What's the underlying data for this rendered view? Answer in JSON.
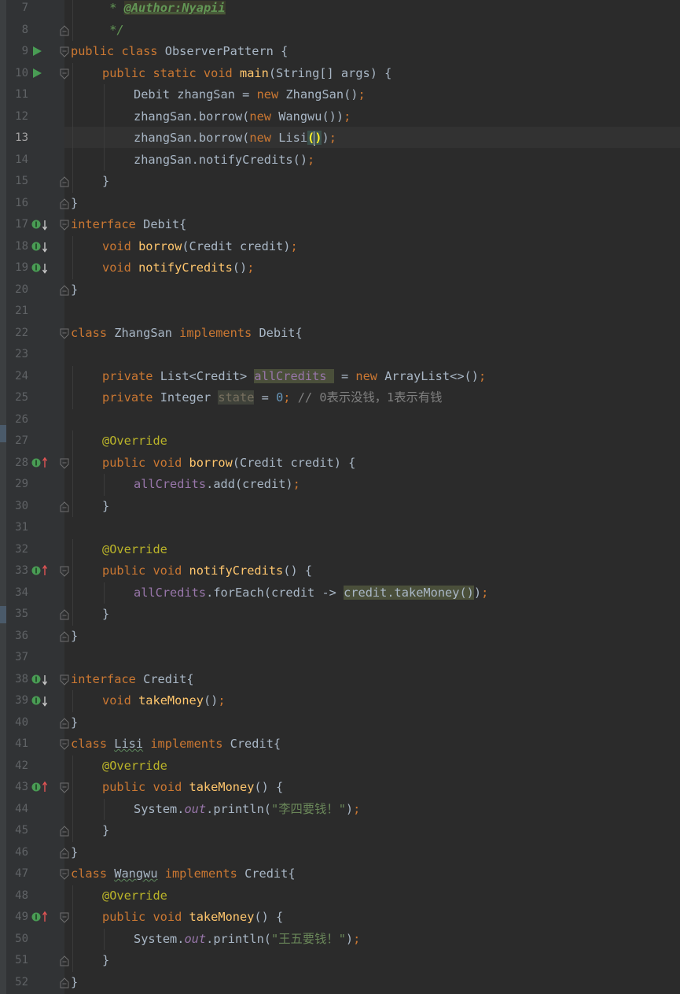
{
  "editor": {
    "current_line": 13,
    "lines": [
      {
        "num": "7",
        "indent": 1,
        "gutter": "",
        "fold": "",
        "tokens": [
          {
            "t": " * ",
            "c": "doc"
          },
          {
            "t": "@Author:Nyapii",
            "c": "dtag"
          }
        ]
      },
      {
        "num": "8",
        "indent": 1,
        "gutter": "",
        "fold": "end",
        "tokens": [
          {
            "t": " */",
            "c": "doc"
          }
        ]
      },
      {
        "num": "9",
        "indent": 0,
        "gutter": "run",
        "fold": "start",
        "tokens": [
          {
            "t": "public class ",
            "c": "kw"
          },
          {
            "t": "ObserverPattern {",
            "c": ""
          }
        ]
      },
      {
        "num": "10",
        "indent": 1,
        "gutter": "run",
        "fold": "start",
        "tokens": [
          {
            "t": "public static void ",
            "c": "kw"
          },
          {
            "t": "main",
            "c": "fn"
          },
          {
            "t": "(String[] args) {",
            "c": ""
          }
        ]
      },
      {
        "num": "11",
        "indent": 2,
        "gutter": "",
        "fold": "",
        "tokens": [
          {
            "t": "Debit zhangSan = ",
            "c": ""
          },
          {
            "t": "new ",
            "c": "kw"
          },
          {
            "t": "ZhangSan()",
            "c": ""
          },
          {
            "t": ";",
            "c": "kw"
          }
        ]
      },
      {
        "num": "12",
        "indent": 2,
        "gutter": "",
        "fold": "",
        "tokens": [
          {
            "t": "zhangSan.borrow(",
            "c": ""
          },
          {
            "t": "new ",
            "c": "kw"
          },
          {
            "t": "Wangwu())",
            "c": ""
          },
          {
            "t": ";",
            "c": "kw"
          }
        ]
      },
      {
        "num": "13",
        "indent": 2,
        "gutter": "",
        "fold": "",
        "tokens": [
          {
            "t": "zhangSan.borrow(",
            "c": ""
          },
          {
            "t": "new ",
            "c": "kw"
          },
          {
            "t": "Lisi",
            "c": ""
          },
          {
            "t": "(",
            "c": "brace-match"
          },
          {
            "t": "",
            "c": "caret"
          },
          {
            "t": ")",
            "c": "brace-match"
          },
          {
            "t": ")",
            "c": ""
          },
          {
            "t": ";",
            "c": "kw"
          }
        ]
      },
      {
        "num": "14",
        "indent": 2,
        "gutter": "",
        "fold": "",
        "tokens": [
          {
            "t": "zhangSan.notifyCredits()",
            "c": ""
          },
          {
            "t": ";",
            "c": "kw"
          }
        ]
      },
      {
        "num": "15",
        "indent": 1,
        "gutter": "",
        "fold": "end",
        "tokens": [
          {
            "t": "}",
            "c": ""
          }
        ]
      },
      {
        "num": "16",
        "indent": 0,
        "gutter": "",
        "fold": "end",
        "tokens": [
          {
            "t": "}",
            "c": ""
          }
        ]
      },
      {
        "num": "17",
        "indent": 0,
        "gutter": "impl",
        "fold": "start",
        "tokens": [
          {
            "t": "interface ",
            "c": "kw"
          },
          {
            "t": "Debit{",
            "c": ""
          }
        ]
      },
      {
        "num": "18",
        "indent": 1,
        "gutter": "impl",
        "fold": "",
        "tokens": [
          {
            "t": "void ",
            "c": "kw"
          },
          {
            "t": "borrow",
            "c": "fn"
          },
          {
            "t": "(Credit credit)",
            "c": ""
          },
          {
            "t": ";",
            "c": "kw"
          }
        ]
      },
      {
        "num": "19",
        "indent": 1,
        "gutter": "impl",
        "fold": "",
        "tokens": [
          {
            "t": "void ",
            "c": "kw"
          },
          {
            "t": "notifyCredits",
            "c": "fn"
          },
          {
            "t": "()",
            "c": ""
          },
          {
            "t": ";",
            "c": "kw"
          }
        ]
      },
      {
        "num": "20",
        "indent": 0,
        "gutter": "",
        "fold": "end",
        "tokens": [
          {
            "t": "}",
            "c": ""
          }
        ]
      },
      {
        "num": "21",
        "indent": 0,
        "gutter": "",
        "fold": "",
        "tokens": []
      },
      {
        "num": "22",
        "indent": 0,
        "gutter": "",
        "fold": "start",
        "tokens": [
          {
            "t": "class ",
            "c": "kw"
          },
          {
            "t": "ZhangSan ",
            "c": ""
          },
          {
            "t": "implements ",
            "c": "kw"
          },
          {
            "t": "Debit{",
            "c": ""
          }
        ]
      },
      {
        "num": "23",
        "indent": 0,
        "gutter": "",
        "fold": "",
        "tokens": []
      },
      {
        "num": "24",
        "indent": 1,
        "gutter": "",
        "fold": "",
        "tokens": [
          {
            "t": "private ",
            "c": "kw"
          },
          {
            "t": "List<Credit> ",
            "c": ""
          },
          {
            "t": "allCredits ",
            "c": "fld hl-usage"
          },
          {
            "t": " = ",
            "c": ""
          },
          {
            "t": "new ",
            "c": "kw"
          },
          {
            "t": "ArrayList<>()",
            "c": ""
          },
          {
            "t": ";",
            "c": "kw"
          }
        ]
      },
      {
        "num": "25",
        "indent": 1,
        "gutter": "",
        "fold": "",
        "tokens": [
          {
            "t": "private ",
            "c": "kw"
          },
          {
            "t": "Integer ",
            "c": ""
          },
          {
            "t": "state",
            "c": "hl-state"
          },
          {
            "t": " = ",
            "c": ""
          },
          {
            "t": "0",
            "c": "num"
          },
          {
            "t": "; ",
            "c": "kw"
          },
          {
            "t": "// 0表示没钱，1表示有钱",
            "c": "cmt"
          }
        ]
      },
      {
        "num": "26",
        "indent": 0,
        "gutter": "",
        "fold": "",
        "tokens": []
      },
      {
        "num": "27",
        "indent": 1,
        "gutter": "",
        "fold": "",
        "tokens": [
          {
            "t": "@Override",
            "c": "ann"
          }
        ]
      },
      {
        "num": "28",
        "indent": 1,
        "gutter": "over",
        "fold": "start",
        "tokens": [
          {
            "t": "public void ",
            "c": "kw"
          },
          {
            "t": "borrow",
            "c": "fn"
          },
          {
            "t": "(Credit credit) {",
            "c": ""
          }
        ]
      },
      {
        "num": "29",
        "indent": 2,
        "gutter": "",
        "fold": "",
        "tokens": [
          {
            "t": "allCredits",
            "c": "fld"
          },
          {
            "t": ".add(credit)",
            "c": ""
          },
          {
            "t": ";",
            "c": "kw"
          }
        ]
      },
      {
        "num": "30",
        "indent": 1,
        "gutter": "",
        "fold": "end",
        "tokens": [
          {
            "t": "}",
            "c": ""
          }
        ]
      },
      {
        "num": "31",
        "indent": 0,
        "gutter": "",
        "fold": "",
        "tokens": []
      },
      {
        "num": "32",
        "indent": 1,
        "gutter": "",
        "fold": "",
        "tokens": [
          {
            "t": "@Override",
            "c": "ann"
          }
        ]
      },
      {
        "num": "33",
        "indent": 1,
        "gutter": "over",
        "fold": "start",
        "tokens": [
          {
            "t": "public void ",
            "c": "kw"
          },
          {
            "t": "notifyCredits",
            "c": "fn"
          },
          {
            "t": "() {",
            "c": ""
          }
        ]
      },
      {
        "num": "34",
        "indent": 2,
        "gutter": "",
        "fold": "",
        "tokens": [
          {
            "t": "allCredits",
            "c": "fld"
          },
          {
            "t": ".forEach(credit -> ",
            "c": ""
          },
          {
            "t": "credit.takeMoney()",
            "c": "hl-usage"
          },
          {
            "t": ")",
            "c": ""
          },
          {
            "t": ";",
            "c": "kw"
          }
        ]
      },
      {
        "num": "35",
        "indent": 1,
        "gutter": "",
        "fold": "end",
        "tokens": [
          {
            "t": "}",
            "c": ""
          }
        ]
      },
      {
        "num": "36",
        "indent": 0,
        "gutter": "",
        "fold": "end",
        "tokens": [
          {
            "t": "}",
            "c": ""
          }
        ]
      },
      {
        "num": "37",
        "indent": 0,
        "gutter": "",
        "fold": "",
        "tokens": []
      },
      {
        "num": "38",
        "indent": 0,
        "gutter": "impl",
        "fold": "start",
        "tokens": [
          {
            "t": "interface ",
            "c": "kw"
          },
          {
            "t": "Credit{",
            "c": ""
          }
        ]
      },
      {
        "num": "39",
        "indent": 1,
        "gutter": "impl",
        "fold": "",
        "tokens": [
          {
            "t": "void ",
            "c": "kw"
          },
          {
            "t": "takeMoney",
            "c": "fn"
          },
          {
            "t": "()",
            "c": ""
          },
          {
            "t": ";",
            "c": "kw"
          }
        ]
      },
      {
        "num": "40",
        "indent": 0,
        "gutter": "",
        "fold": "end",
        "tokens": [
          {
            "t": "}",
            "c": ""
          }
        ]
      },
      {
        "num": "41",
        "indent": 0,
        "gutter": "",
        "fold": "start",
        "tokens": [
          {
            "t": "class ",
            "c": "kw"
          },
          {
            "t": "Lisi",
            "c": "typo"
          },
          {
            "t": " ",
            "c": ""
          },
          {
            "t": "implements ",
            "c": "kw"
          },
          {
            "t": "Credit{",
            "c": ""
          }
        ]
      },
      {
        "num": "42",
        "indent": 1,
        "gutter": "",
        "fold": "",
        "tokens": [
          {
            "t": "@Override",
            "c": "ann"
          }
        ]
      },
      {
        "num": "43",
        "indent": 1,
        "gutter": "over",
        "fold": "start",
        "tokens": [
          {
            "t": "public void ",
            "c": "kw"
          },
          {
            "t": "takeMoney",
            "c": "fn"
          },
          {
            "t": "() {",
            "c": ""
          }
        ]
      },
      {
        "num": "44",
        "indent": 2,
        "gutter": "",
        "fold": "",
        "tokens": [
          {
            "t": "System.",
            "c": ""
          },
          {
            "t": "out",
            "c": "st"
          },
          {
            "t": ".println(",
            "c": ""
          },
          {
            "t": "\"李四要钱！\"",
            "c": "str"
          },
          {
            "t": ")",
            "c": ""
          },
          {
            "t": ";",
            "c": "kw"
          }
        ]
      },
      {
        "num": "45",
        "indent": 1,
        "gutter": "",
        "fold": "end",
        "tokens": [
          {
            "t": "}",
            "c": ""
          }
        ]
      },
      {
        "num": "46",
        "indent": 0,
        "gutter": "",
        "fold": "end",
        "tokens": [
          {
            "t": "}",
            "c": ""
          }
        ]
      },
      {
        "num": "47",
        "indent": 0,
        "gutter": "",
        "fold": "start",
        "tokens": [
          {
            "t": "class ",
            "c": "kw"
          },
          {
            "t": "Wangwu",
            "c": "typo"
          },
          {
            "t": " ",
            "c": ""
          },
          {
            "t": "implements ",
            "c": "kw"
          },
          {
            "t": "Credit{",
            "c": ""
          }
        ]
      },
      {
        "num": "48",
        "indent": 1,
        "gutter": "",
        "fold": "",
        "tokens": [
          {
            "t": "@Override",
            "c": "ann"
          }
        ]
      },
      {
        "num": "49",
        "indent": 1,
        "gutter": "over",
        "fold": "start",
        "tokens": [
          {
            "t": "public void ",
            "c": "kw"
          },
          {
            "t": "takeMoney",
            "c": "fn"
          },
          {
            "t": "() {",
            "c": ""
          }
        ]
      },
      {
        "num": "50",
        "indent": 2,
        "gutter": "",
        "fold": "",
        "tokens": [
          {
            "t": "System.",
            "c": ""
          },
          {
            "t": "out",
            "c": "st"
          },
          {
            "t": ".println(",
            "c": ""
          },
          {
            "t": "\"王五要钱！\"",
            "c": "str"
          },
          {
            "t": ")",
            "c": ""
          },
          {
            "t": ";",
            "c": "kw"
          }
        ]
      },
      {
        "num": "51",
        "indent": 1,
        "gutter": "",
        "fold": "end",
        "tokens": [
          {
            "t": "}",
            "c": ""
          }
        ]
      },
      {
        "num": "52",
        "indent": 0,
        "gutter": "",
        "fold": "end",
        "tokens": [
          {
            "t": "}",
            "c": ""
          }
        ]
      }
    ]
  },
  "colors": {
    "background": "#2b2b2b",
    "gutter": "#313335",
    "keyword": "#cc7832",
    "method": "#ffc66d",
    "field": "#9876aa",
    "string": "#6a8759",
    "number": "#6897bb",
    "annotation": "#bbb529",
    "run_icon": "#499c54",
    "override_icon": "#499c54",
    "override_arrow": "#e05555"
  }
}
